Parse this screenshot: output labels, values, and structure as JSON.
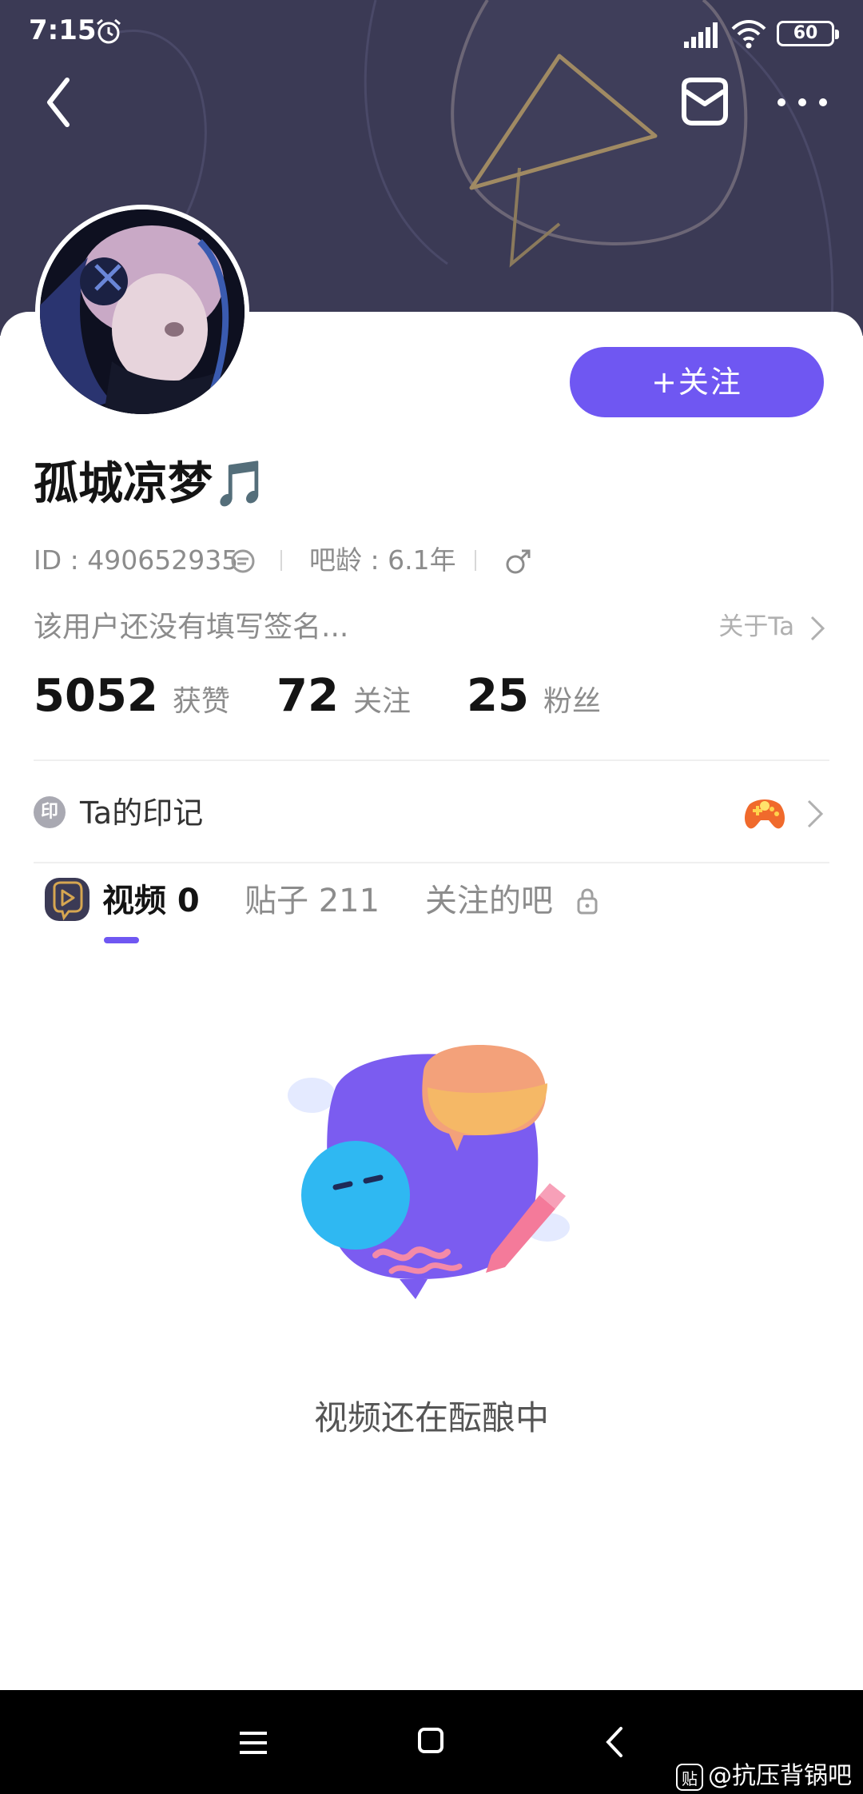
{
  "status_bar": {
    "time": "7:15",
    "battery": "60"
  },
  "profile": {
    "follow_label": "+关注",
    "username": "孤城凉梦🎵",
    "id_text": "ID : 490652935",
    "bar_age": "吧龄 : 6.1年",
    "signature": "该用户还没有填写签名...",
    "about_label": "关于Ta"
  },
  "stats": [
    {
      "value": "5052",
      "label": "获赞"
    },
    {
      "value": "72",
      "label": "关注"
    },
    {
      "value": "25",
      "label": "粉丝"
    }
  ],
  "imprint": {
    "badge": "印",
    "title": "Ta的印记"
  },
  "tabs": [
    {
      "label": "视频 0"
    },
    {
      "label": "贴子 211"
    },
    {
      "label": "关注的吧"
    }
  ],
  "empty_state": {
    "text": "视频还在酝酿中"
  },
  "watermark": {
    "badge": "贴",
    "text": "@抗压背锅吧"
  },
  "colors": {
    "accent": "#6f57f2",
    "header_bg": "#3b3a55"
  }
}
